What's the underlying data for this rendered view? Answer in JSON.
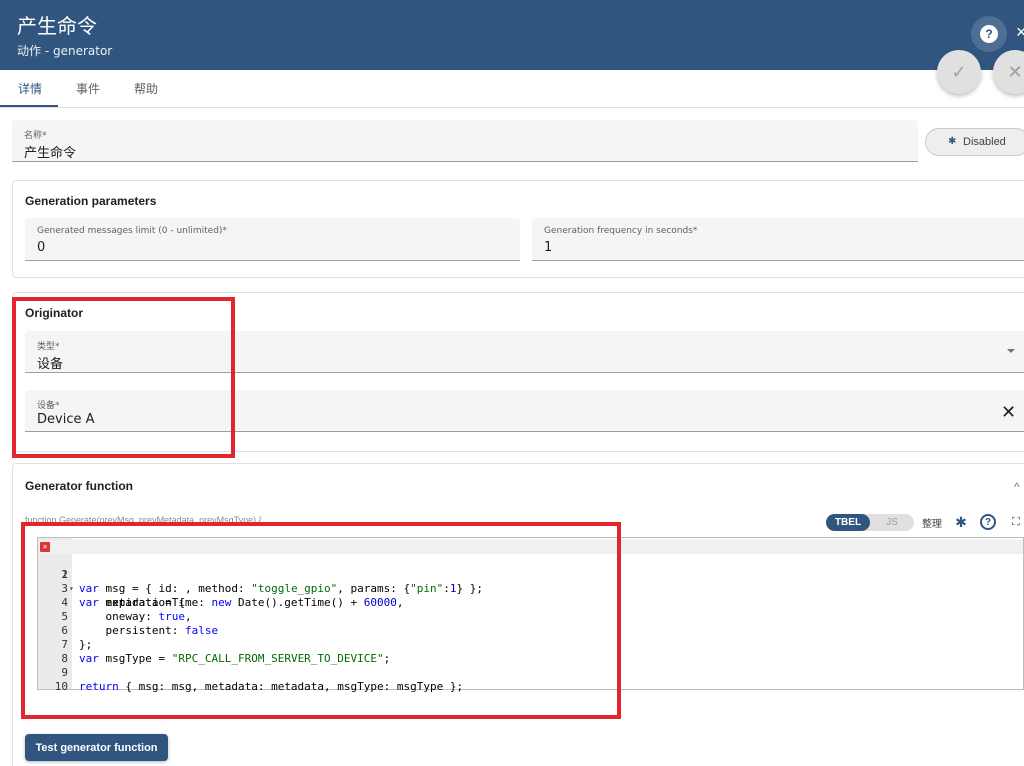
{
  "header": {
    "title": "产生命令",
    "subtitle": "动作 - generator"
  },
  "tabs": [
    {
      "label": "详情"
    },
    {
      "label": "事件"
    },
    {
      "label": "帮助"
    }
  ],
  "name_field": {
    "label": "名称*",
    "value": "产生命令"
  },
  "debug_button": {
    "label": "Disabled"
  },
  "generation": {
    "title": "Generation parameters",
    "limit": {
      "label": "Generated messages limit (0 - unlimited)*",
      "value": "0"
    },
    "frequency": {
      "label": "Generation frequency in seconds*",
      "value": "1"
    }
  },
  "originator": {
    "title": "Originator",
    "type": {
      "label": "类型*",
      "value": "设备"
    },
    "device": {
      "label": "设备*",
      "value": "Device A"
    }
  },
  "generator_fn": {
    "title": "Generator function",
    "signature": "function Generate(prevMsg, prevMetadata, prevMsgType) {",
    "toggle_on": "TBEL",
    "toggle_off": "JS",
    "tidy_label": "整理",
    "line_numbers": [
      "1",
      "2",
      "3",
      "4",
      "5",
      "6",
      "7",
      "8",
      "9",
      "10"
    ],
    "lines": [
      "var msg = { id: , method: \"toggle_gpio\", params: {\"pin\":1} };",
      "var metadata = {",
      "    expirationTime: new Date().getTime() + 60000,",
      "    oneway: true,",
      "    persistent: false",
      "};",
      "var msgType = \"RPC_CALL_FROM_SERVER_TO_DEVICE\";",
      "",
      "return { msg: msg, metadata: metadata, msgType: msgType };",
      ""
    ]
  },
  "test_button": {
    "label": "Test generator function"
  },
  "colors": {
    "primary": "#305680",
    "highlight_box": "#e3262d"
  }
}
